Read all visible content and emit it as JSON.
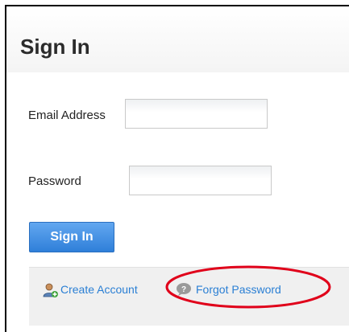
{
  "page": {
    "title": "Sign In"
  },
  "form": {
    "email_label": "Email Address",
    "email_value": "",
    "password_label": "Password",
    "password_value": "",
    "submit_label": "Sign In"
  },
  "footer": {
    "create_account_label": "Create Account",
    "create_account_icon": "add-user-icon",
    "forgot_password_label": "Forgot Password",
    "forgot_password_icon": "help-bubble-icon"
  },
  "colors": {
    "button": "#2f7fd9",
    "link": "#2a7fd4",
    "annotation": "#e0001a"
  }
}
